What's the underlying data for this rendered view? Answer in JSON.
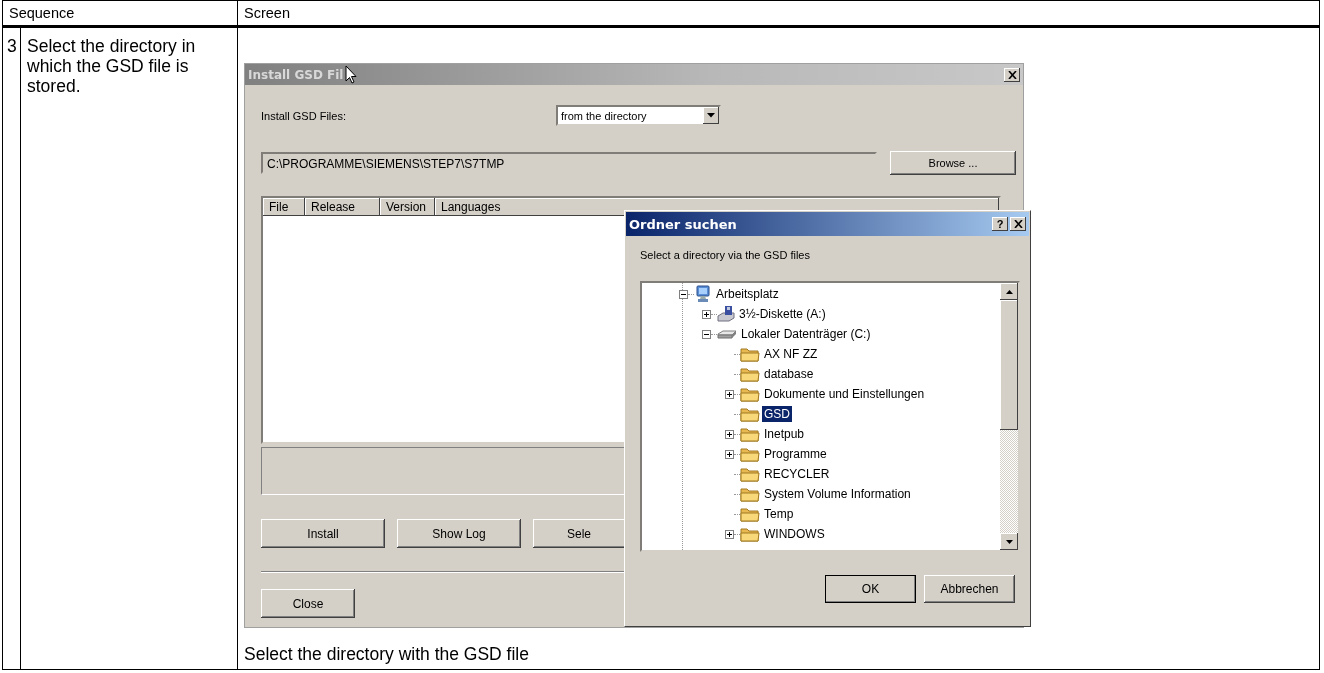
{
  "table": {
    "columns": [
      "Sequence",
      "Screen"
    ],
    "rows": [
      {
        "step": "3",
        "instruction": "Select the directory in which the GSD file is stored.",
        "caption": "Select the directory with the GSD file"
      }
    ]
  },
  "install_dialog": {
    "title": "Install GSD Fil",
    "source_label": "Install GSD Files:",
    "source_value": "from the directory",
    "path": "C:\\PROGRAMME\\SIEMENS\\STEP7\\S7TMP",
    "browse_button": "Browse ...",
    "list_columns": [
      "File",
      "Release",
      "Version",
      "Languages"
    ],
    "buttons": [
      "Install",
      "Show Log",
      "Sele"
    ],
    "close_button": "Close"
  },
  "folder_dialog": {
    "title": "Ordner suchen",
    "help_button": "?",
    "prompt": "Select a directory via the GSD files",
    "tree": [
      {
        "label": "Arbeitsplatz",
        "kind": "computer",
        "expanded": true,
        "selected": false,
        "children": [
          {
            "label": "3½-Diskette (A:)",
            "kind": "floppy",
            "expanded": false,
            "selected": false
          },
          {
            "label": "Lokaler Datenträger (C:)",
            "kind": "drive",
            "expanded": true,
            "selected": false,
            "children": [
              {
                "label": "AX NF ZZ",
                "kind": "folder",
                "selected": false
              },
              {
                "label": "database",
                "kind": "folder",
                "selected": false
              },
              {
                "label": "Dokumente und Einstellungen",
                "kind": "folder",
                "expanded": false,
                "selected": false
              },
              {
                "label": "GSD",
                "kind": "folder",
                "selected": true
              },
              {
                "label": "Inetpub",
                "kind": "folder",
                "expanded": false,
                "selected": false
              },
              {
                "label": "Programme",
                "kind": "folder",
                "expanded": false,
                "selected": false
              },
              {
                "label": "RECYCLER",
                "kind": "folder",
                "selected": false
              },
              {
                "label": "System Volume Information",
                "kind": "folder",
                "selected": false
              },
              {
                "label": "Temp",
                "kind": "folder",
                "selected": false
              },
              {
                "label": "WINDOWS",
                "kind": "folder",
                "expanded": false,
                "selected": false
              }
            ]
          }
        ]
      }
    ],
    "buttons": [
      {
        "label": "OK",
        "default": true
      },
      {
        "label": "Abbrechen",
        "default": false
      }
    ]
  }
}
